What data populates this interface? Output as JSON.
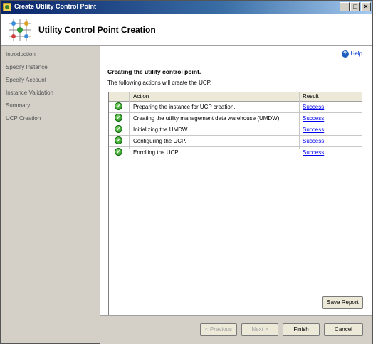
{
  "window": {
    "title": "Create Utility Control Point"
  },
  "titlebar_buttons": {
    "minimize": "_",
    "maximize": "□",
    "close": "×"
  },
  "header": {
    "title": "Utility Control Point Creation",
    "icon": "utility-grid-icon"
  },
  "sidebar": {
    "items": [
      {
        "label": "Introduction"
      },
      {
        "label": "Specify Instance"
      },
      {
        "label": "Specify Account"
      },
      {
        "label": "Instance Validation"
      },
      {
        "label": "Summary"
      },
      {
        "label": "UCP Creation"
      }
    ]
  },
  "help": {
    "label": "Help",
    "icon": "help-icon"
  },
  "main": {
    "title": "Creating the utility control point.",
    "description": "The following actions will create the UCP."
  },
  "table": {
    "columns": [
      "Action",
      "Result"
    ],
    "rows": [
      {
        "action": "Preparing the instance for UCP creation.",
        "result": "Success"
      },
      {
        "action": "Creating the utility management data warehouse (UMDW).",
        "result": "Success"
      },
      {
        "action": "Initializing the UMDW.",
        "result": "Success"
      },
      {
        "action": "Configuring the UCP.",
        "result": "Success"
      },
      {
        "action": "Enrolling the UCP.",
        "result": "Success"
      }
    ]
  },
  "buttons": {
    "save_report": "Save Report",
    "previous": "< Previous",
    "next": "Next >",
    "finish": "Finish",
    "cancel": "Cancel"
  },
  "colors": {
    "success": "#1f8a1a",
    "link": "#0000ee",
    "titlebar": "#0a246a"
  }
}
